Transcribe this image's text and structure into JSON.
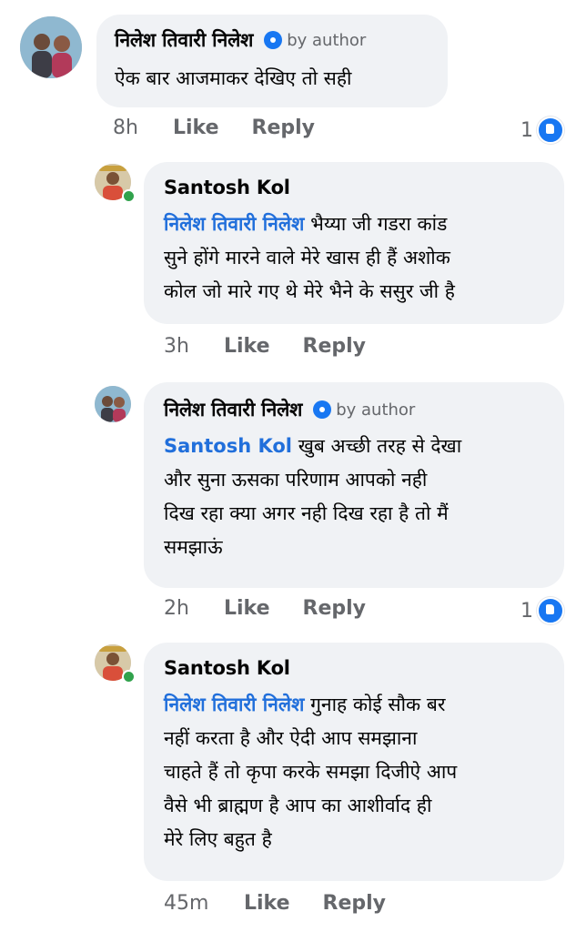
{
  "comments": [
    {
      "author": "निलेश तिवारी निलेश",
      "badge": "by author",
      "mention": "",
      "text": "ऐक बार आजमाकर देखिए तो सही",
      "time": "8h",
      "like_label": "Like",
      "reply_label": "Reply",
      "reactions": "1",
      "avatar_icon": "profile-photo-couple"
    },
    {
      "author": "Santosh Kol",
      "mention": "निलेश तिवारी निलेश",
      "text_lines": [
        "भैय्या जी गडरा कांड",
        "सुने होंगे मारने वाले मेरे खास ही हैं अशोक",
        "कोल जो मारे गए थे मेरे भैने के ससुर जी है"
      ],
      "time": "3h",
      "like_label": "Like",
      "reply_label": "Reply",
      "avatar_icon": "profile-photo-man"
    },
    {
      "author": "निलेश तिवारी निलेश",
      "badge": "by author",
      "mention": "Santosh Kol",
      "text_lines": [
        "खुब अच्छी तरह से देखा",
        "और सुना ऊसका परिणाम आपको नही",
        "दिख रहा क्या अगर नही दिख रहा है तो मैं",
        "समझाऊं"
      ],
      "time": "2h",
      "like_label": "Like",
      "reply_label": "Reply",
      "reactions": "1",
      "avatar_icon": "profile-photo-couple"
    },
    {
      "author": "Santosh Kol",
      "mention": "निलेश तिवारी निलेश",
      "text_lines": [
        "गुनाह कोई सौक बर",
        "नहीं करता है और ऐदी आप समझाना",
        "चाहते हैं तो कृपा करके समझा दिजीऐ आप",
        "वैसे भी ब्राह्मण है आप का आशीर्वाद ही",
        "मेरे लिए बहुत है"
      ],
      "time": "45m",
      "like_label": "Like",
      "reply_label": "Reply",
      "avatar_icon": "profile-photo-man"
    }
  ],
  "colors": {
    "mention": "#216fdb",
    "bubble": "#f0f2f5",
    "reaction": "#1877f2",
    "online": "#31a24c"
  }
}
